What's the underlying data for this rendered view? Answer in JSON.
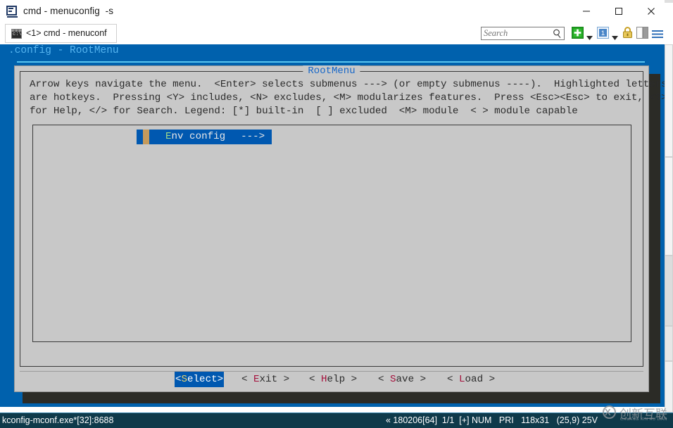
{
  "window": {
    "title": "cmd - menuconfig  -s",
    "icon": "console-window-icon",
    "minimize_label": "—",
    "maximize_label": "□",
    "close_label": "✕"
  },
  "tabs": [
    {
      "label": "<1> cmd - menuconf",
      "icon": "cmd-console-icon",
      "active": true
    }
  ],
  "toolbar": {
    "search": {
      "placeholder": "Search",
      "value": "",
      "icon": "search-icon"
    },
    "icons": [
      {
        "name": "new-tab-plus-icon",
        "glyph": "+"
      },
      {
        "name": "new-tab-dropdown-caret-icon",
        "glyph": "▾"
      },
      {
        "name": "window-number-one-icon",
        "glyph": "1"
      },
      {
        "name": "window-list-dropdown-caret-icon",
        "glyph": "▾"
      },
      {
        "name": "lock-icon",
        "glyph": "🔒"
      },
      {
        "name": "split-panel-icon",
        "glyph": "▣"
      },
      {
        "name": "hamburger-menu-icon",
        "glyph": "☰"
      }
    ]
  },
  "console": {
    "header": ".config - RootMenu",
    "panel_title": "RootMenu",
    "help_text_lines": [
      "Arrow keys navigate the menu.  <Enter> selects submenus ---> (or empty submenus ----).  Highlighted letters",
      "are hotkeys.  Pressing <Y> includes, <N> excludes, <M> modularizes features.  Press <Esc><Esc> to exit, <?>",
      "for Help, </> for Search. Legend: [*] built-in  [ ] excluded  <M> module  < > module capable"
    ],
    "menu_items": [
      {
        "hotkey": "E",
        "label_rest": "nv config",
        "full_label": "Env config",
        "arrow": "--->",
        "selected": true
      }
    ],
    "buttons": [
      {
        "id": "select",
        "prefix": "<",
        "hotkey": "S",
        "rest": "elect",
        "suffix": ">",
        "selected": true
      },
      {
        "id": "exit",
        "prefix": "< ",
        "hotkey": "E",
        "rest": "xit",
        "suffix": " >",
        "selected": false
      },
      {
        "id": "help",
        "prefix": "< ",
        "hotkey": "H",
        "rest": "elp",
        "suffix": " >",
        "selected": false
      },
      {
        "id": "save",
        "prefix": "< ",
        "hotkey": "S",
        "rest": "ave",
        "suffix": " >",
        "selected": false
      },
      {
        "id": "load",
        "prefix": "< ",
        "hotkey": "L",
        "rest": "oad",
        "suffix": " >",
        "selected": false
      }
    ]
  },
  "statusbar": {
    "left": "kconfig-mconf.exe*[32]:8688",
    "right": "« 180206[64]  1/1  [+] NUM   PRI   118x31   (25,9) 25V"
  },
  "watermark": {
    "mark": "X",
    "chinese": "创新互联",
    "pinyin": "CHUANG XIN HU LIAN"
  },
  "colors": {
    "console_bg": "#0061ad",
    "header_text": "#56b5f0",
    "dialog_bg": "#c8c8c8",
    "selection_bg": "#0058b0",
    "hotkey_red": "#a5103c",
    "hotkey_green": "#9fd98a",
    "hotkey_yellow": "#e8d36a",
    "statusbar_bg": "#0f3a4a"
  }
}
